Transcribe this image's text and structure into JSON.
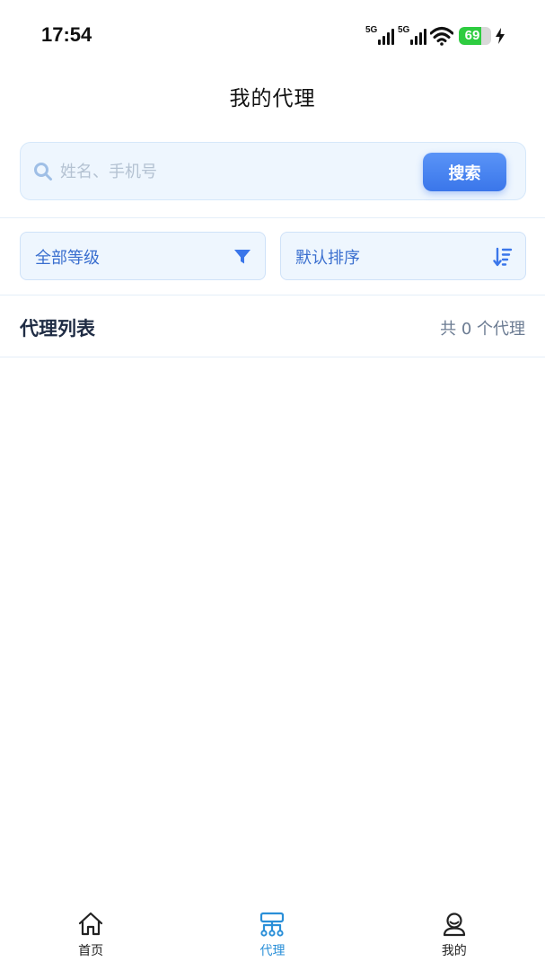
{
  "status_bar": {
    "time": "17:54",
    "network_1": "5G",
    "network_2": "5G",
    "battery_level": "69",
    "icons": [
      "signal-icon",
      "signal-icon",
      "wifi-icon",
      "battery-icon",
      "charging-icon"
    ]
  },
  "header": {
    "title": "我的代理"
  },
  "search": {
    "placeholder": "姓名、手机号",
    "value": "",
    "button_label": "搜索",
    "icon": "search-icon"
  },
  "filters": {
    "level": {
      "label": "全部等级",
      "icon": "filter-icon"
    },
    "sort": {
      "label": "默认排序",
      "icon": "sort-icon"
    }
  },
  "list": {
    "title": "代理列表",
    "count_text": "共 0 个代理",
    "items": []
  },
  "tabs": [
    {
      "label": "首页",
      "icon": "home-icon",
      "active": false
    },
    {
      "label": "代理",
      "icon": "agent-network-icon",
      "active": true
    },
    {
      "label": "我的",
      "icon": "profile-icon",
      "active": false
    }
  ],
  "colors": {
    "accent": "#3a76ea",
    "active_tab": "#2a8fd8",
    "search_bg": "#eef6fe",
    "filter_text": "#3a6fcf",
    "battery_green": "#2ecc40"
  }
}
